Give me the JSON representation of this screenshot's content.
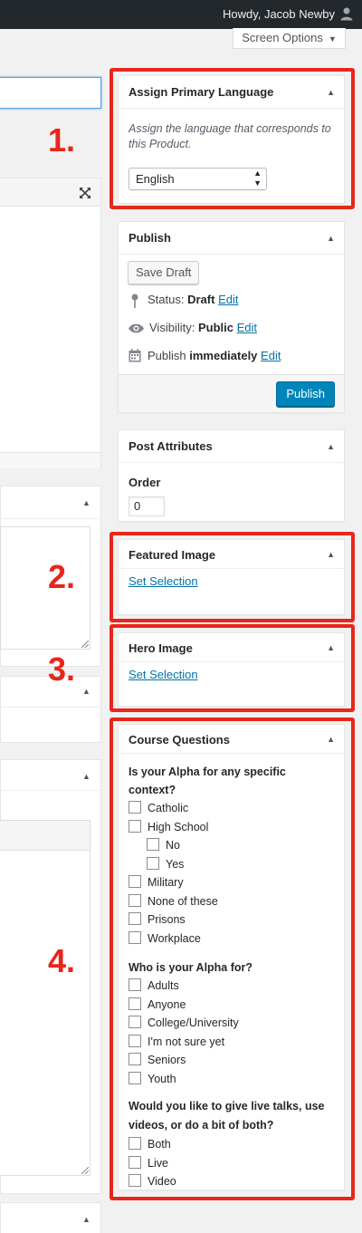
{
  "adminbar": {
    "greeting": "Howdy, Jacob Newby",
    "user_icon": "user-icon"
  },
  "screen_options": {
    "label": "Screen Options",
    "arrow": "▼"
  },
  "language_box": {
    "title": "Assign Primary Language",
    "description": "Assign the language that corresponds to this Product.",
    "selected_language": "English"
  },
  "publish_box": {
    "title": "Publish",
    "save_draft": "Save Draft",
    "status_label": "Status:",
    "status_value": "Draft",
    "visibility_label": "Visibility:",
    "visibility_value": "Public",
    "publish_label": "Publish",
    "publish_value": "immediately",
    "edit": "Edit",
    "publish_button": "Publish"
  },
  "post_attributes": {
    "title": "Post Attributes",
    "order_label": "Order",
    "order_value": "0"
  },
  "featured_image": {
    "title": "Featured Image",
    "link": "Set Selection"
  },
  "hero_image": {
    "title": "Hero Image",
    "link": "Set Selection"
  },
  "course_questions": {
    "title": "Course Questions",
    "groups": [
      {
        "question": "Is your Alpha for any specific context?",
        "options": [
          "Catholic",
          "High School",
          "No",
          "Yes",
          "Military",
          "None of these",
          "Prisons",
          "Workplace"
        ]
      },
      {
        "question": "Who is your Alpha for?",
        "options": [
          "Adults",
          "Anyone",
          "College/University",
          "I'm not sure yet",
          "Seniors",
          "Youth"
        ]
      },
      {
        "question_line1": "Would you like to give live talks, use",
        "question_line2": "videos, or do a bit of both?",
        "options": [
          "Both",
          "Live",
          "Video"
        ]
      }
    ]
  },
  "annotations": {
    "n1": "1.",
    "n2": "2.",
    "n3": "3.",
    "n4": "4."
  },
  "colors": {
    "annotation_red": "#e9261b",
    "primary_button": "#0085ba",
    "link": "#0073aa",
    "adminbar": "#23282d"
  }
}
